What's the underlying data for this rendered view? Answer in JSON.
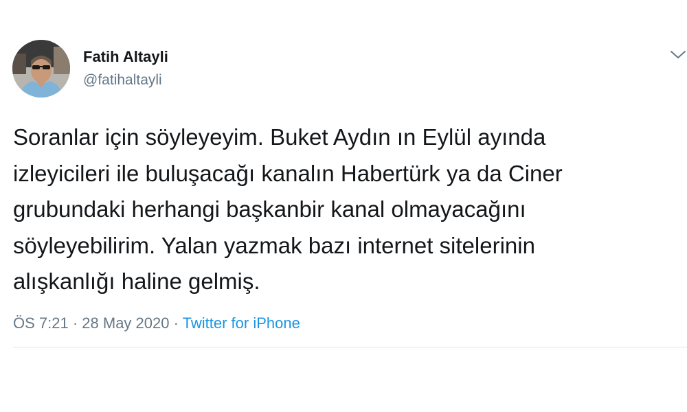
{
  "author": {
    "name": "Fatih Altayli",
    "handle": "@fatihaltayli",
    "avatar_icon": "profile-photo"
  },
  "tweet": {
    "lines": [
      "Soranlar için söyleyeyim. Buket Aydın ın Eylül ayında",
      "izleyicileri ile buluşacağı kanalın Habertürk ya da Ciner",
      "grubundaki herhangi başkanbir kanal olmayacağını",
      "söyleyebilirim. Yalan yazmak bazı internet sitelerinin",
      "alışkanlığı haline gelmiş."
    ]
  },
  "meta": {
    "time": "ÖS 7:21",
    "separator": " · ",
    "date": "28 May 2020",
    "source": "Twitter for iPhone"
  },
  "icons": {
    "menu": "chevron-down-icon"
  },
  "colors": {
    "text": "#14171a",
    "secondary": "#657786",
    "link": "#1b95e0",
    "divider": "#e1e8ed"
  }
}
